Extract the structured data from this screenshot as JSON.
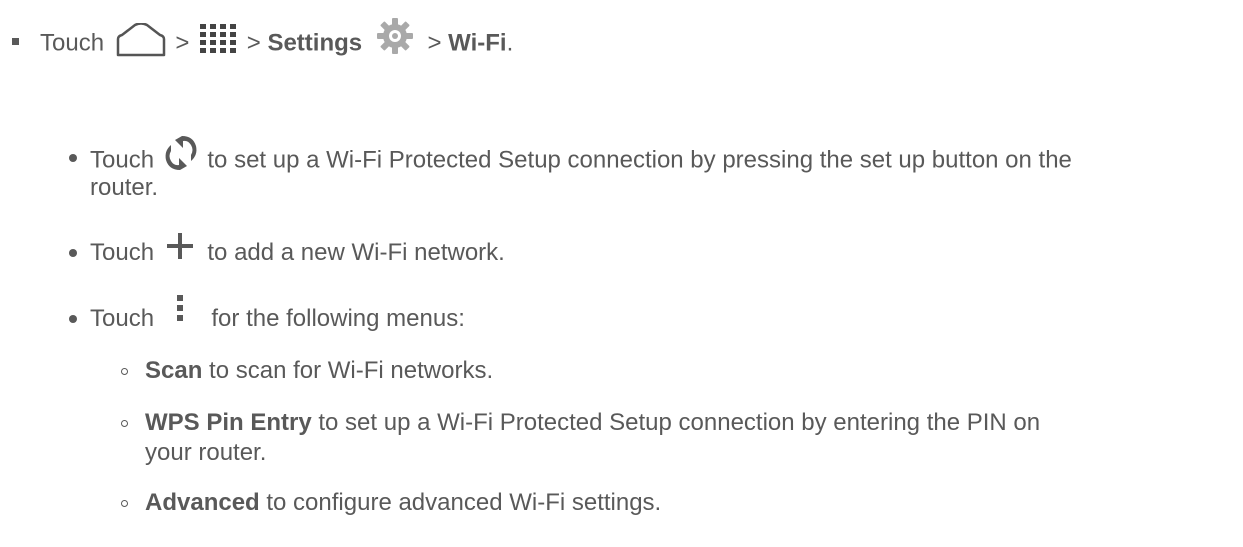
{
  "step": {
    "touch": "Touch",
    "sep1": ">",
    "sep2": ">",
    "settings": "Settings",
    "sep3": ">",
    "wifi": "Wi-Fi",
    "end": ".",
    "icons": [
      "home-icon",
      "apps-grid-icon",
      "settings-gear-icon"
    ]
  },
  "bullets": [
    {
      "touch": "Touch",
      "icon": "wps-icon",
      "text": "to set up a Wi-Fi Protected Setup connection by pressing the set up button on the",
      "text2": "router."
    },
    {
      "touch": "Touch",
      "icon": "add-icon",
      "text": "to add a new Wi-Fi network."
    },
    {
      "touch": "Touch",
      "icon": "menu-icon",
      "text": "for the following menus:"
    }
  ],
  "subbullets": [
    {
      "term": "Scan",
      "text": "to scan for Wi-Fi networks."
    },
    {
      "term": "WPS Pin Entry",
      "text": "to set up a Wi-Fi Protected Setup connection by entering the PIN on",
      "text2": "your router."
    },
    {
      "term": "Advanced",
      "text": "to configure advanced Wi-Fi settings."
    }
  ],
  "colors": {
    "text": "#595959",
    "icon": "#666666"
  }
}
